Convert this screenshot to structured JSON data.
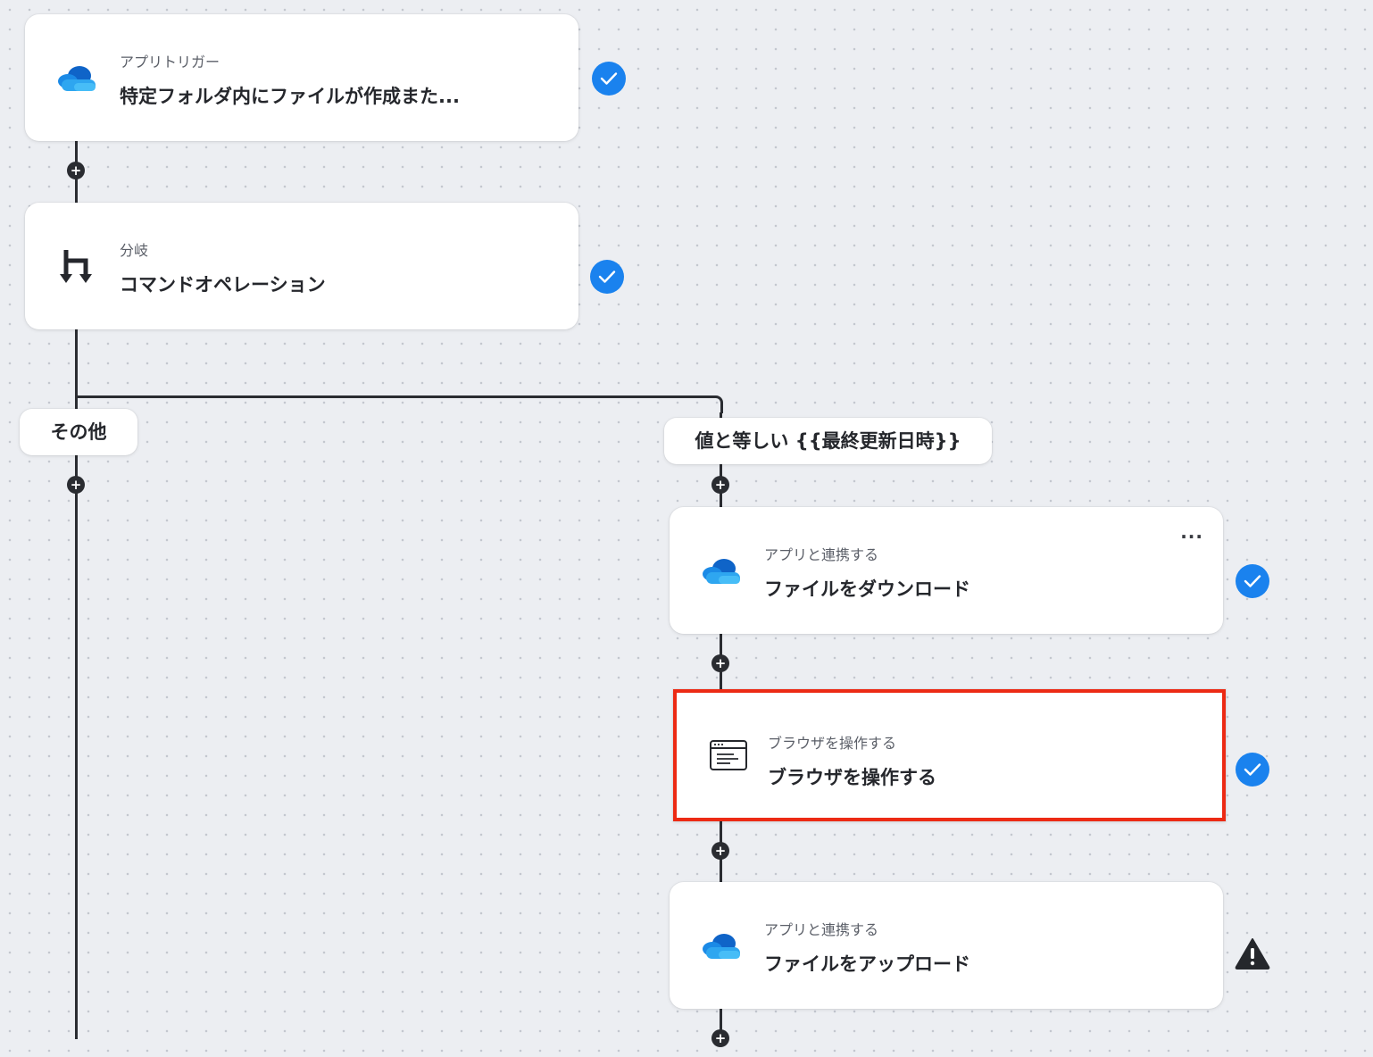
{
  "colors": {
    "accent": "#1a82ee",
    "highlight": "#ec2a14",
    "connector": "#2a2c31"
  },
  "steps": [
    {
      "kicker": "アプリトリガー",
      "title": "特定フォルダ内にファイルが作成また...",
      "icon": "onedrive-icon",
      "status": "completed"
    },
    {
      "kicker": "分岐",
      "title": "コマンドオペレーション",
      "icon": "branch-icon",
      "status": "completed"
    },
    {
      "kicker": "アプリと連携する",
      "title": "ファイルをダウンロード",
      "icon": "onedrive-icon",
      "status": "completed",
      "menu": "..."
    },
    {
      "kicker": "ブラウザを操作する",
      "title": "ブラウザを操作する",
      "icon": "browser-window-icon",
      "status": "completed",
      "highlighted": true
    },
    {
      "kicker": "アプリと連携する",
      "title": "ファイルをアップロード",
      "icon": "onedrive-icon",
      "status": "warning"
    }
  ],
  "branches": {
    "other_label": "その他",
    "condition_label": "値と等しい {{最終更新日時}}"
  },
  "add_symbol": "+"
}
